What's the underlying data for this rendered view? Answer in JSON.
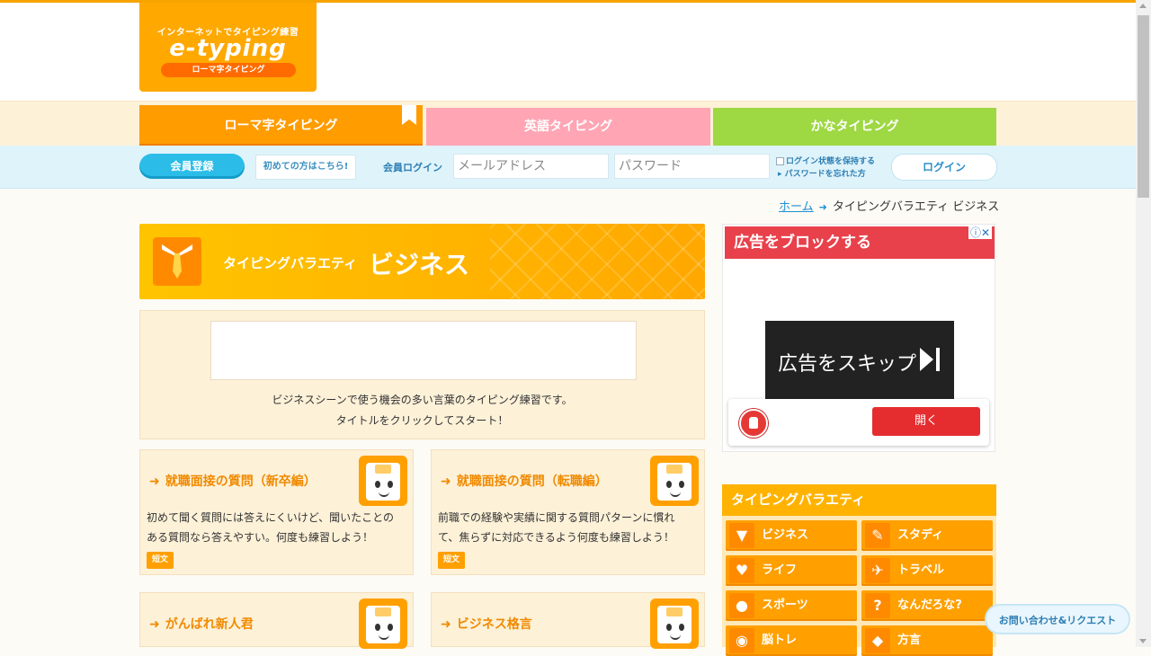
{
  "logo": {
    "tagline": "インターネットでタイピング練習",
    "name": "e-typing",
    "subtitle": "ローマ字タイピング"
  },
  "tabs": [
    {
      "label": "ローマ字タイピング",
      "active": true
    },
    {
      "label": "英語タイピング",
      "active": false
    },
    {
      "label": "かなタイピング",
      "active": false
    }
  ],
  "login": {
    "register_label": "会員登録",
    "first_time_label": "初めての方はこちら!",
    "login_label": "会員ログイン",
    "email_placeholder": "メールアドレス",
    "password_placeholder": "パスワード",
    "keep_login_label": "ログイン状態を保持する",
    "forgot_password_label": "パスワードを忘れた方",
    "login_button_label": "ログイン"
  },
  "breadcrumb": {
    "home": "ホーム",
    "current": "タイピングバラエティ ビジネス"
  },
  "banner": {
    "subtitle": "タイピングバラエティ",
    "title": "ビジネス"
  },
  "description": {
    "line1": "ビジネスシーンで使う機会の多い言葉のタイピング練習です。",
    "line2": "タイトルをクリックしてスタート！"
  },
  "cards": [
    {
      "title": "就職面接の質問（新卒編）",
      "text": "初めて聞く質問には答えにくいけど、聞いたことのある質問なら答えやすい。何度も練習しよう！",
      "badge": "短文"
    },
    {
      "title": "就職面接の質問（転職編）",
      "text": "前職での経験や実績に関する質問パターンに慣れて、焦らずに対応できるよう何度も練習しよう！",
      "badge": "短文"
    },
    {
      "title": "がんばれ新人君",
      "text": "",
      "badge": ""
    },
    {
      "title": "ビジネス格言",
      "text": "",
      "badge": ""
    }
  ],
  "ad": {
    "header": "広告をブロックする",
    "header_icons": "ⓘ✕",
    "skip_label": "広告をスキップ",
    "open_label": "開く"
  },
  "variety": {
    "heading": "タイピングバラエティ",
    "items": [
      {
        "label": "ビジネス",
        "icon": "tie-icon"
      },
      {
        "label": "スタディ",
        "icon": "pencil-icon"
      },
      {
        "label": "ライフ",
        "icon": "heart-icon"
      },
      {
        "label": "トラベル",
        "icon": "airplane-icon"
      },
      {
        "label": "スポーツ",
        "icon": "ball-icon"
      },
      {
        "label": "なんだろな?",
        "icon": "question-icon"
      },
      {
        "label": "脳トレ",
        "icon": "brain-icon"
      },
      {
        "label": "方言",
        "icon": "map-icon"
      }
    ]
  },
  "contact": {
    "label": "お問い合わせ&リクエスト"
  },
  "colors": {
    "brand_orange": "#ffa800",
    "english_pink": "#ffa5b4",
    "kana_green": "#9ed843",
    "login_blue": "#2bbde8",
    "ad_red": "#e8414b"
  }
}
